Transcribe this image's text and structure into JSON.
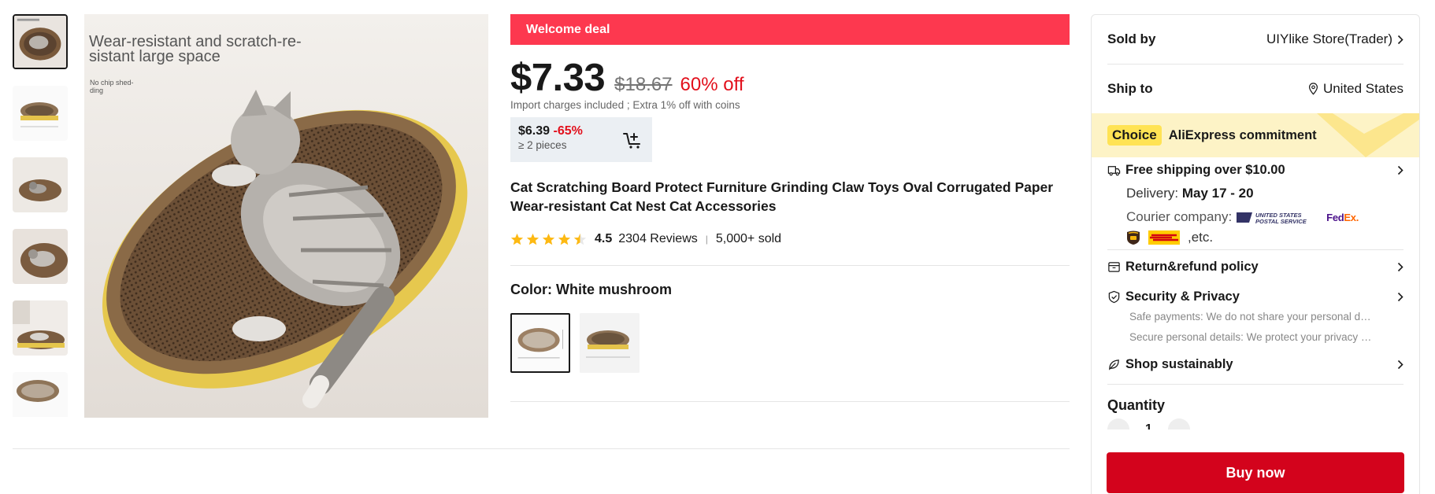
{
  "gallery": {
    "thumbnails": [
      "thumb-1",
      "thumb-2",
      "thumb-3",
      "thumb-4",
      "thumb-5",
      "thumb-6"
    ],
    "main_caption": "Wear-resistant and scratch-re-sistant large space",
    "main_note": "No chip shed-ding"
  },
  "deal": {
    "banner": "Welcome deal"
  },
  "price": {
    "current": "$7.33",
    "original": "$18.67",
    "discount": "60% off",
    "import_note": "Import charges included ; Extra 1% off with coins"
  },
  "bulk": {
    "price": "$6.39",
    "percent": "-65%",
    "pieces": "≥ 2 pieces"
  },
  "product": {
    "title": "Cat Scratching Board Protect Furniture Grinding Claw Toys Oval Corrugated Paper Wear-resistant Cat Nest Cat Accessories"
  },
  "rating": {
    "stars_value": 4.5,
    "value": "4.5",
    "reviews": "2304 Reviews",
    "sold": "5,000+ sold"
  },
  "variant": {
    "label": "Color: White mushroom",
    "options": [
      "White mushroom",
      "Yellow"
    ],
    "selected_index": 0
  },
  "panel": {
    "sold_by_label": "Sold by",
    "store": "UIYlike Store(Trader)",
    "ship_to_label": "Ship to",
    "country": "United States",
    "choice_badge": "Choice",
    "commitment": "AliExpress commitment",
    "free_shipping": "Free shipping over $10.00",
    "delivery_label": "Delivery:",
    "delivery_dates": "May 17 - 20",
    "courier_label": "Courier company:",
    "courier_etc": ",etc.",
    "usps_text": "UNITED STATES POSTAL SERVICE",
    "fedex_fe": "Fed",
    "fedex_ex": "Ex",
    "fedex_dot": ".",
    "return_policy": "Return&refund policy",
    "security": "Security & Privacy",
    "safe_payments": "Safe payments: We do not share your personal details with any third-party sellers",
    "secure_details": "Secure personal details: We protect your privacy and keep your personal details safe and secure",
    "sustainably": "Shop sustainably",
    "quantity_label": "Quantity",
    "quantity_value": "1",
    "buy_now": "Buy now"
  },
  "colors": {
    "deal_red": "#fd384f",
    "price_red": "#e2101c",
    "buy_red": "#d3031c",
    "choice_yellow": "#ffe354",
    "choice_band": "#fdf3c6"
  }
}
